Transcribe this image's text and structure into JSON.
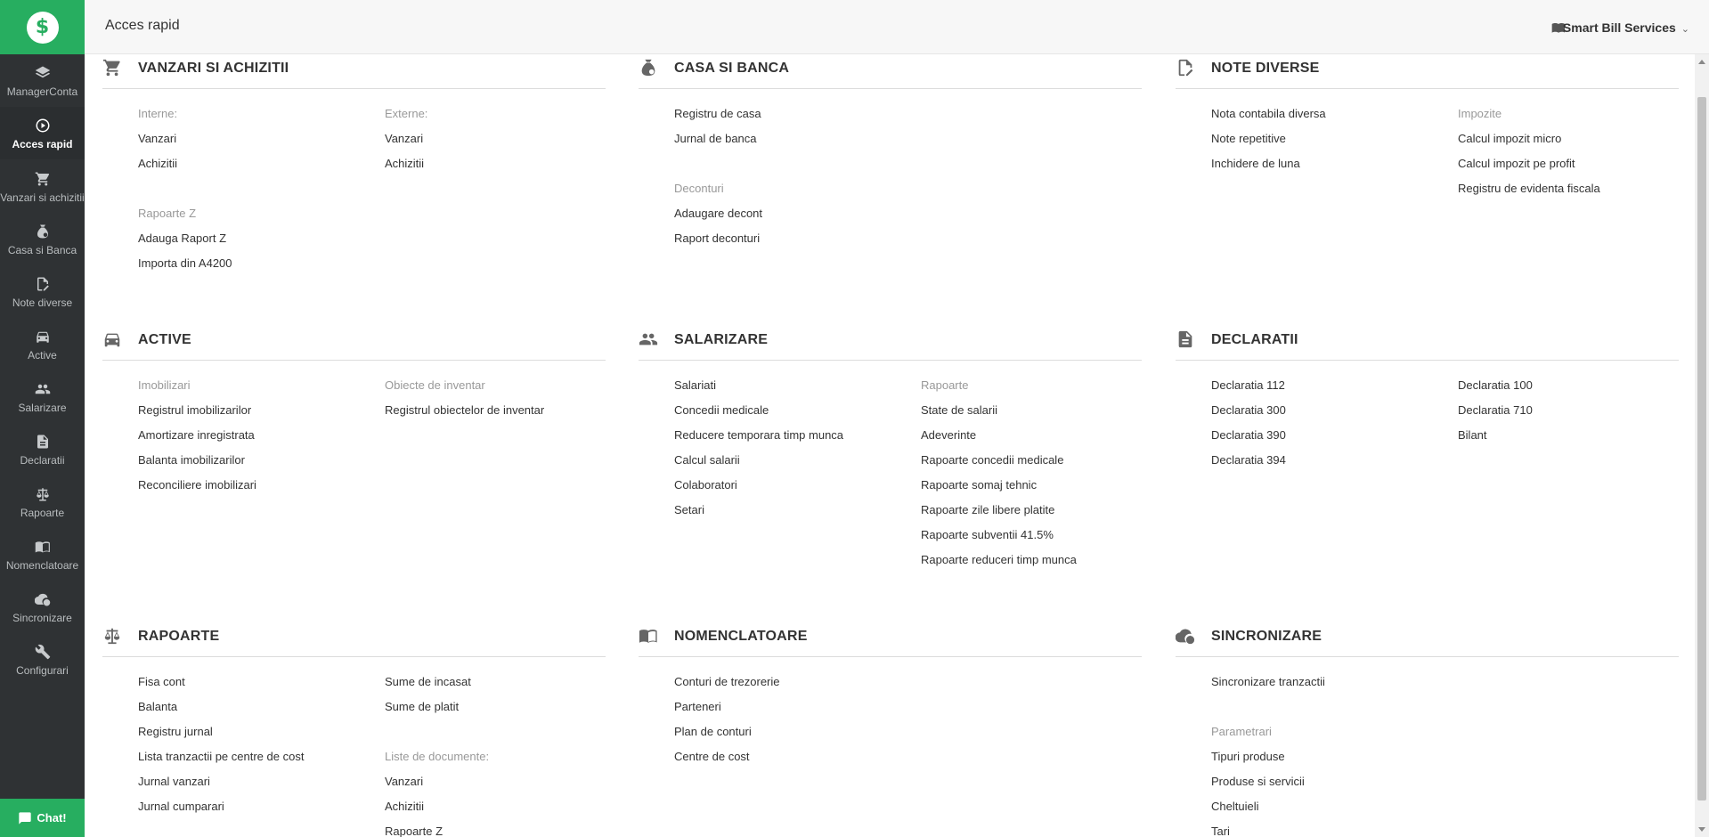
{
  "header": {
    "title": "Acces rapid",
    "company": "Smart Bill Services",
    "chevron": "⌄",
    "help_icon": "book-help-icon"
  },
  "logo": {
    "symbol": "$",
    "color": "#27ae60"
  },
  "sidebar": {
    "items": [
      {
        "label": "ManagerConta",
        "icon": "layers-icon"
      },
      {
        "label": "Acces rapid",
        "icon": "play-circle-icon"
      },
      {
        "label": "Vanzari si achizitii",
        "icon": "cart-icon"
      },
      {
        "label": "Casa si Banca",
        "icon": "money-bag-icon"
      },
      {
        "label": "Note diverse",
        "icon": "note-edit-icon"
      },
      {
        "label": "Active",
        "icon": "car-icon"
      },
      {
        "label": "Salarizare",
        "icon": "people-icon"
      },
      {
        "label": "Declaratii",
        "icon": "document-icon"
      },
      {
        "label": "Rapoarte",
        "icon": "scales-icon"
      },
      {
        "label": "Nomenclatoare",
        "icon": "open-book-icon"
      },
      {
        "label": "Sincronizare",
        "icon": "cloud-sync-icon"
      },
      {
        "label": "Configurari",
        "icon": "wrench-icon"
      }
    ],
    "chat": "Chat!"
  },
  "sections": {
    "vanzari": {
      "title": "VANZARI SI ACHIZITII",
      "icon": "cart-icon",
      "col1": [
        "Interne:",
        "Vanzari",
        "Achizitii",
        "",
        "Rapoarte Z",
        "Adauga Raport Z",
        "Importa din A4200"
      ],
      "col2": [
        "Externe:",
        "Vanzari",
        "Achizitii"
      ]
    },
    "casa": {
      "title": "CASA SI BANCA",
      "icon": "money-bag-icon",
      "col1": [
        "Registru de casa",
        "Jurnal de banca",
        "",
        "Deconturi",
        "Adaugare decont",
        "Raport deconturi"
      ]
    },
    "note": {
      "title": "NOTE DIVERSE",
      "icon": "note-edit-icon",
      "col1": [
        "Nota contabila diversa",
        "Note repetitive",
        "Inchidere de luna"
      ],
      "col2": [
        "Impozite",
        "Calcul impozit micro",
        "Calcul impozit pe profit",
        "Registru de evidenta fiscala"
      ]
    },
    "active": {
      "title": "ACTIVE",
      "icon": "car-icon",
      "col1": [
        "Imobilizari",
        "Registrul imobilizarilor",
        "Amortizare inregistrata",
        "Balanta imobilizarilor",
        "Reconciliere imobilizari"
      ],
      "col2": [
        "Obiecte de inventar",
        "Registrul obiectelor de inventar"
      ]
    },
    "salarizare": {
      "title": "SALARIZARE",
      "icon": "people-icon",
      "col1": [
        "Salariati",
        "Concedii medicale",
        "Reducere temporara timp munca",
        "Calcul salarii",
        "Colaboratori",
        "Setari"
      ],
      "col2": [
        "Rapoarte",
        "State de salarii",
        "Adeverinte",
        "Rapoarte concedii medicale",
        "Rapoarte somaj tehnic",
        "Rapoarte zile libere platite",
        "Rapoarte subventii 41.5%",
        "Rapoarte reduceri timp munca"
      ]
    },
    "declaratii": {
      "title": "DECLARATII",
      "icon": "document-icon",
      "col1": [
        "Declaratia 112",
        "Declaratia 300",
        "Declaratia 390",
        "Declaratia 394"
      ],
      "col2": [
        "Declaratia 100",
        "Declaratia 710",
        "Bilant"
      ]
    },
    "rapoarte": {
      "title": "RAPOARTE",
      "icon": "scales-icon",
      "col1": [
        "Fisa cont",
        "Balanta",
        "Registru jurnal",
        "Lista tranzactii pe centre de cost",
        "Jurnal vanzari",
        "Jurnal cumparari"
      ],
      "col2": [
        "Sume de incasat",
        "Sume de platit",
        "",
        "Liste de documente:",
        "Vanzari",
        "Achizitii",
        "Rapoarte Z"
      ]
    },
    "nomenclatoare": {
      "title": "NOMENCLATOARE",
      "icon": "open-book-icon",
      "col1": [
        "Conturi de trezorerie",
        "Parteneri",
        "Plan de conturi",
        "Centre de cost"
      ]
    },
    "sincronizare": {
      "title": "SINCRONIZARE",
      "icon": "cloud-sync-icon",
      "col1": [
        "Sincronizare tranzactii",
        "",
        "Parametrari",
        "Tipuri produse",
        "Produse si servicii",
        "Cheltuieli",
        "Tari"
      ]
    }
  },
  "labels": [
    "Interne:",
    "Externe:",
    "Rapoarte Z",
    "Deconturi",
    "Impozite",
    "Imobilizari",
    "Obiecte de inventar",
    "Rapoarte",
    "Liste de documente:",
    "Parametrari"
  ]
}
